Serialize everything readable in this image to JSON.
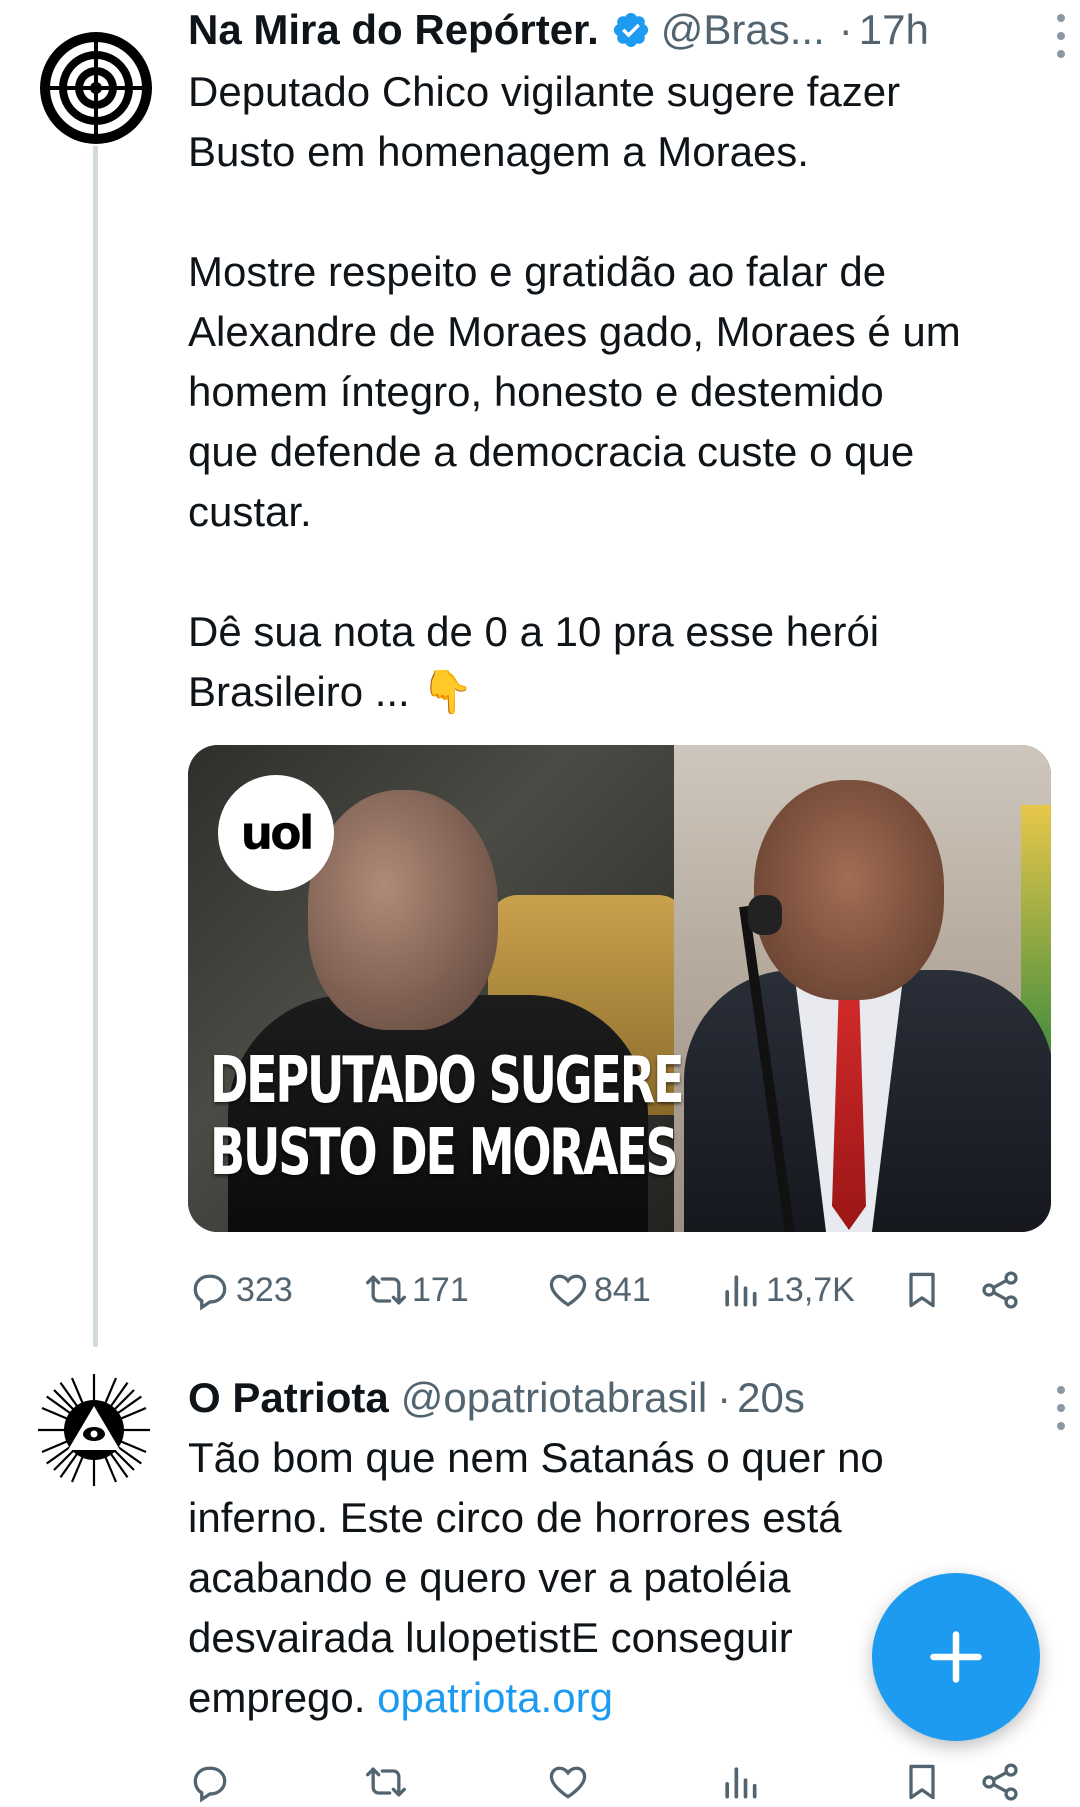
{
  "tweets": [
    {
      "author_name": "Na Mira do Repórter.",
      "handle": "@Bras...",
      "separator": "·",
      "time": "17h",
      "body": [
        "Deputado Chico vigilante sugere fazer",
        "Busto em homenagem a Moraes.",
        "",
        "Mostre respeito e gratidão ao falar de",
        "Alexandre de Moraes gado, Moraes é um",
        "homem íntegro, honesto e destemido",
        "que defende a democracia custe o que",
        "custar.",
        "",
        "Dê sua nota de 0 a 10 pra esse herói",
        "Brasileiro ... 👇"
      ],
      "media": {
        "logo_text": "uol",
        "headline_line1": "DEPUTADO SUGERE",
        "headline_line2": "BUSTO DE MORAES"
      },
      "stats": {
        "replies": "323",
        "retweets": "171",
        "likes": "841",
        "views": "13,7K"
      }
    },
    {
      "author_name": "O Patriota",
      "handle": "@opatriotabrasil",
      "separator": "·",
      "time": "20s",
      "body": [
        "Tão bom que nem Satanás o quer no",
        "inferno. Este circo de horrores está",
        "acabando e quero ver a patoléia",
        "desvairada lulopetistE conseguir",
        "emprego. "
      ],
      "link_text": "opatriota.org"
    }
  ],
  "colors": {
    "accent": "#1d9bf0",
    "secondary_text": "#536471",
    "thread_line": "#cfd9de"
  },
  "icons": {
    "verified": "verified-badge-icon",
    "more": "more-vertical-icon",
    "reply": "reply-icon",
    "retweet": "retweet-icon",
    "like": "heart-icon",
    "views": "views-chart-icon",
    "bookmark": "bookmark-icon",
    "share": "share-icon",
    "compose": "plus-icon"
  }
}
